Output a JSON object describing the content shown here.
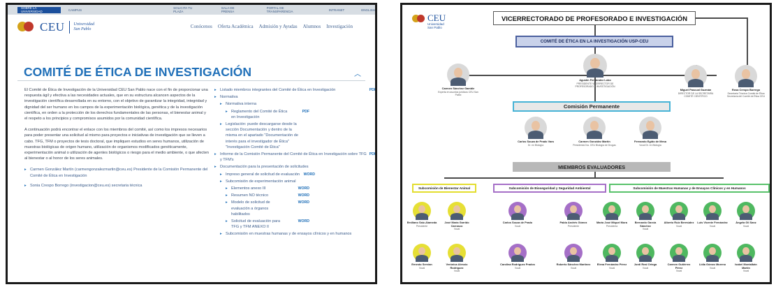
{
  "left": {
    "topbar": {
      "tabs": [
        "SOBRE LA UNIVERSIDAD",
        "CAMPUS"
      ],
      "utilities": [
        "SOLICITA TU PLAZA",
        "SALA DE PRENSA",
        "PORTAL DE TRANSPARENCIA",
        "INTRANET",
        "ENGLISH"
      ]
    },
    "brand": {
      "name": "CEU",
      "sub1": "Universidad",
      "sub2": "San Pablo"
    },
    "nav": [
      "Conócenos",
      "Oferta Académica",
      "Admisión y Ayudas",
      "Alumnos",
      "Investigación"
    ],
    "page_title": "COMITÉ DE ÉTICA DE INVESTIGACIÓN",
    "paragraphs": [
      "El Comité de Ética de Investigación de la Universidad CEU San Pablo nace con el fin de proporcionar una respuesta ágil y efectiva a las necesidades actuales, que en su estructura alcancen aspectos de la investigación científica desarrollada en su entorno, con el objetivo de garantizar la integridad, integridad y dignidad del ser humano en los campos de la experimentación biológica, genética y de la investigación científica, en orden a la protección de los derechos fundamentales de las personas, el bienestar animal y el respeto a los principios y compromisos asumidos por la comunidad científica.",
      "A continuación podrá encontrar el enlace con los miembros del comité, así como los impresos necesarios para poder presentar una solicitud al mismo para proyectos e iniciativas de investigación que se lleven a cabo. TFG, TFM o proyectos de tesis doctoral, que impliquen estudios en seres humanos, utilización de muestras biológicas de origen humano, utilización de organismos modificados genéticamente, experimentación animal o utilización de agentes biológicos o riesgo para el medio ambiente, o que afecten al bienestar o al honor de los seres animales."
    ],
    "contacts": [
      "Carmen González Martín (carmengonzalezmartin@ceu.es) Presidente de la Comisión Permanente del Comité de Ética en Investigación",
      "Sonia Crespo Borrego (investigacion@ceu.es) secretaria técnica"
    ],
    "right_items": {
      "members": "Listado miembros integrantes del Comité de Ética en Investigación",
      "normativa": "Normativa",
      "normativa_interna": "Normativa interna",
      "reglamento": "Reglamento del Comité de Ética en Investigación",
      "legislacion": "Legislación: puede descargarse desde la sección Documentación y dentro de la misma en el apartado \"Documentación de interés para el investigador de Ética\" \"Investigación Comité de Ética\"",
      "informe": "Informe de la Comisión Permanente del Comité de Ética en Investigación sobre TFG y TFM's",
      "documentacion": "Documentación para la presentación de solicitudes",
      "impreso": "Impreso general de solicitud de evaluación",
      "subcomision": "Subcomisión de experimentación animal",
      "elementos": "Elementos anexo III",
      "resumen": "Resumen NO técnico",
      "modelo": "Modelo de solicitud de evaluación a órganos habilitados",
      "solicitud_tfg": "Solicitud de evaluación para TFG y TFM ANEXO II",
      "subcomision_muestras": "Subcomisión en muestras humanas y de ensayos clínicos y en humanos"
    },
    "badges": {
      "pdf": "PDF",
      "word": "WORD"
    }
  },
  "right": {
    "logo": {
      "name": "CEU",
      "sub1": "Universidad",
      "sub2": "San Pablo"
    },
    "vicerrectorado": "VICERRECTORADO DE PROFESORADO E INVESTIGACIÓN",
    "comite": "COMITÉ DE ÉTICA EN LA INVESTIGACIÓN USP-CEU",
    "top_people": [
      {
        "name": "Carmen Sánchez Gamble",
        "role": "Experta en asuntos jurídicos CEU San Pablo"
      },
      {
        "name": "Agustín Fernández Lobo",
        "role": "PRESIDENTE VICERRECTOR DE PROFESORADO E INVESTIGACIÓN"
      },
      {
        "name": "Miguel Pascual Guzmán",
        "role": "DIRECTOR DE LA SECRETARÍA COMITÉ CIENTÍFICO"
      },
      {
        "name": "Rosa Crespo Borrego",
        "role": "Secretaria Técnica Comité de Ética Secretaría del Comité de Ética CEU"
      }
    ],
    "comision": "Comisión Permanente",
    "comision_people": [
      {
        "name": "Carlos Souza de Prado Vara",
        "role": "Dr. en Biología"
      },
      {
        "name": "Carmen González Martín",
        "role": "Presidenta Dra. CEU Biología de Drogas"
      },
      {
        "name": "Fernando Egido de Mesa",
        "role": "Vocal Dr. en Biología"
      }
    ],
    "miembros": "MIEMBROS EVALUADORES",
    "subcomisiones": [
      "Subcomisión de Bienestar Animal",
      "Subcomisión de Bioseguridad y Seguridad Ambiental",
      "Subcomisión de Muestras Humanas y de Ensayos Clínicos y en Humanos"
    ],
    "animal_people": [
      {
        "name": "Emiliano Saiz-Alameda",
        "role": "Presidente"
      },
      {
        "name": "José María Garrido Carrasco",
        "role": "Vocal"
      },
      {
        "name": "Ernesto Servian",
        "role": "Vocal"
      },
      {
        "name": "Verónica Alessio Rodríguez",
        "role": "Vocal"
      }
    ],
    "bio_people": [
      {
        "name": "Carlos Souza de Prado",
        "role": "Vocal"
      },
      {
        "name": "Pablo Andrés Gómez",
        "role": "Presidente"
      },
      {
        "name": "Carolina Rodríguez Prados",
        "role": "Vocal"
      },
      {
        "name": "Roberto Sánchez Martínez",
        "role": "Vocal"
      }
    ],
    "human_people": [
      {
        "name": "María José Miquel Mora",
        "role": "Presidenta"
      },
      {
        "name": "Bernardo García Sánchez",
        "role": "Vocal"
      },
      {
        "name": "Alberto Ruiz Bermúdez",
        "role": "Vocal"
      },
      {
        "name": "Luis Vicente Fernández",
        "role": "Vocal"
      },
      {
        "name": "Ángela Gil Sanz",
        "role": "Vocal"
      },
      {
        "name": "Elena Fernández Pérez",
        "role": "Vocal"
      },
      {
        "name": "Jordi Real Ortega",
        "role": "Vocal"
      },
      {
        "name": "Carmen Gutiérrez Pérez",
        "role": "Vocal"
      },
      {
        "name": "Lidia Gómez Moreno",
        "role": "Vocal"
      },
      {
        "name": "Isabel Montalbán Martín",
        "role": "Vocal"
      }
    ]
  }
}
